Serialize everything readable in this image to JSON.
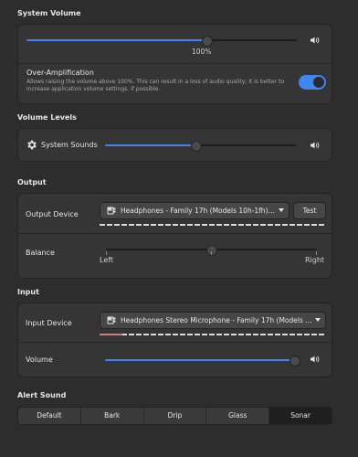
{
  "system_volume": {
    "title": "System Volume",
    "level": 0.67,
    "percent_label": "100%",
    "over_amp": {
      "title": "Over-Amplification",
      "description_line1": "Allows raising the volume above 100%. This can result in a loss of audio quality; it is better to",
      "description_line2": "increase application volume settings, if possible.",
      "enabled": true
    }
  },
  "volume_levels": {
    "title": "Volume Levels",
    "system_sounds_label": "System Sounds",
    "system_sounds_level": 0.48
  },
  "output": {
    "title": "Output",
    "device_label": "Output Device",
    "device_value": "Headphones - Family 17h (Models 10h-1fh) H…",
    "test_label": "Test",
    "balance_label": "Balance",
    "balance_left": "Left",
    "balance_right": "Right",
    "balance_value": 0.5
  },
  "input": {
    "title": "Input",
    "device_label": "Input Device",
    "device_value": "Headphones Stereo Microphone - Family 17h (Models 1…",
    "volume_label": "Volume",
    "volume_level": 1.0
  },
  "alert_sound": {
    "title": "Alert Sound",
    "options": [
      "Default",
      "Bark",
      "Drip",
      "Glass",
      "Sonar"
    ],
    "selected": "Sonar"
  },
  "colors": {
    "accent": "#3f86f2",
    "background": "#2d2d2d",
    "card": "#353535"
  }
}
